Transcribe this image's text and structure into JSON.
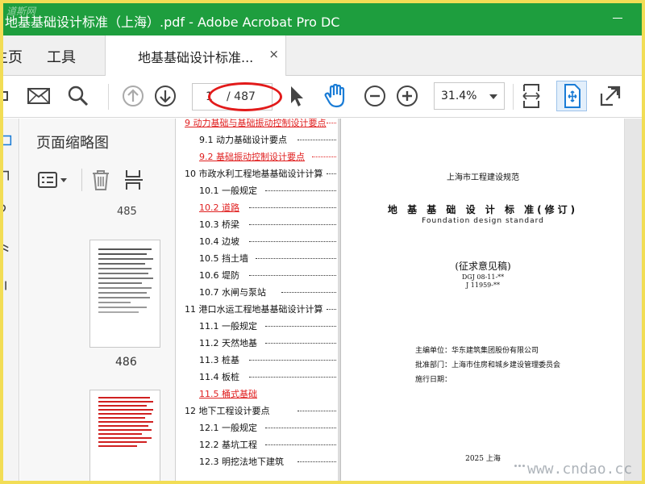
{
  "window": {
    "title": "地基基础设计标准（上海）.pdf - Adobe Acrobat Pro DC",
    "watermark": "道斯网"
  },
  "tabbar": {
    "home_label": "主页",
    "tools_label": "工具",
    "doc_tab_label": "地基基础设计标准...",
    "close_glyph": "×"
  },
  "toolbar": {
    "current_page": "1",
    "total_pages": "/ 487",
    "zoom": "31.4%"
  },
  "thumbnails": {
    "panel_title": "页面缩略图",
    "labels": [
      "485",
      "486"
    ]
  },
  "toc": [
    {
      "label": "9  动力基础与基础振动控制设计要点",
      "red": true,
      "strike": false
    },
    {
      "label": "9.1   动力基础设计要点",
      "red": false
    },
    {
      "label": "9.2   基础振动控制设计要点",
      "red": true
    },
    {
      "label": "10  市政水利工程地基基础设计计算",
      "red": false
    },
    {
      "label": "10.1   一般规定",
      "red": false
    },
    {
      "label": "10.2   道路",
      "red": true
    },
    {
      "label": "10.3   桥梁",
      "red": false
    },
    {
      "label": "10.4   边坡",
      "red": false
    },
    {
      "label": "10.5   挡土墙",
      "red": false
    },
    {
      "label": "10.6   堤防",
      "red": false
    },
    {
      "label": "10.7  水闸与泵站",
      "red": false
    },
    {
      "label": "11  港口水运工程地基基础设计计算",
      "red": false
    },
    {
      "label": "11.1   一般规定",
      "red": false
    },
    {
      "label": "11.2   天然地基",
      "red": false
    },
    {
      "label": "11.3   桩基",
      "red": false
    },
    {
      "label": "11.4   板桩",
      "red": false
    },
    {
      "label": "11.5   桶式基础",
      "red": true
    },
    {
      "label": "12  地下工程设计要点",
      "red": false
    },
    {
      "label": "12.1   一般规定",
      "red": false
    },
    {
      "label": "12.2   基坑工程",
      "red": false
    },
    {
      "label": "12.3   明挖法地下建筑",
      "red": false
    }
  ],
  "cover": {
    "standard": "上海市工程建设规范",
    "title": "地 基 基 础 设 计 标 准(修订)",
    "english": "Foundation design standard",
    "draft": "(征求意见稿)",
    "code1": "DGJ 08-11-**",
    "code2": "J 11959-**",
    "editor": "主编单位：华东建筑集团股份有限公司",
    "approver": "批准部门：上海市住房和城乡建设管理委员会",
    "date_label": "施行日期：",
    "year": "2025  上海"
  },
  "site_watermark": "www.cndao.cc",
  "colors": {
    "titlebar": "#1e9e3e",
    "highlight_red": "#e21a1a",
    "active_blue": "#1a7cd6",
    "outer_border": "#f2dd55"
  }
}
